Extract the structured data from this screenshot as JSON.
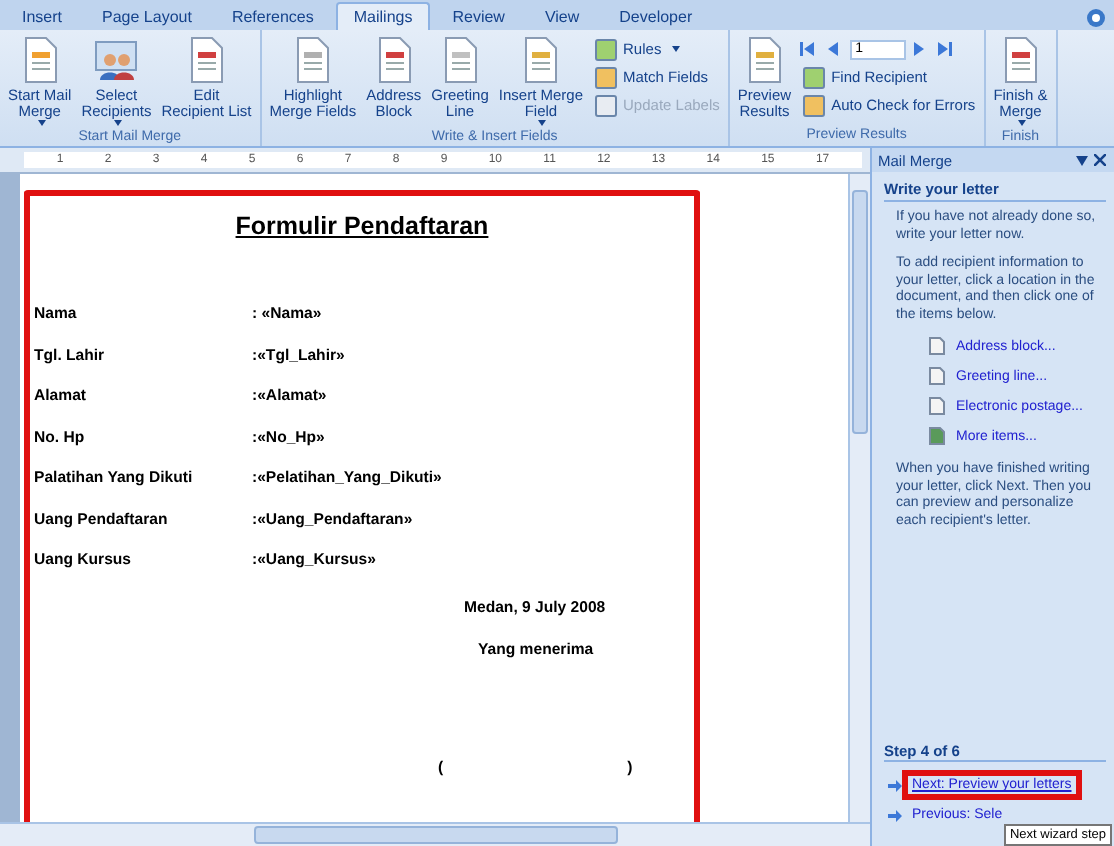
{
  "tabs": [
    {
      "label": "Insert",
      "selected": false
    },
    {
      "label": "Page Layout",
      "selected": false
    },
    {
      "label": "References",
      "selected": false
    },
    {
      "label": "Mailings",
      "selected": true
    },
    {
      "label": "Review",
      "selected": false
    },
    {
      "label": "View",
      "selected": false
    },
    {
      "label": "Developer",
      "selected": false
    }
  ],
  "ribbon_groups": [
    {
      "title": "Start Mail Merge",
      "items": [
        {
          "kind": "large",
          "label": "Start Mail\nMerge",
          "has_menu": true
        },
        {
          "kind": "large",
          "label": "Select\nRecipients",
          "has_menu": true
        },
        {
          "kind": "large",
          "label": "Edit\nRecipient List",
          "has_menu": false
        }
      ]
    },
    {
      "title": "Write & Insert Fields",
      "items": [
        {
          "kind": "large",
          "label": "Highlight\nMerge Fields",
          "has_menu": false
        },
        {
          "kind": "large",
          "label": "Address\nBlock",
          "has_menu": false
        },
        {
          "kind": "large",
          "label": "Greeting\nLine",
          "has_menu": false
        },
        {
          "kind": "large",
          "label": "Insert Merge\nField",
          "has_menu": true
        },
        {
          "kind": "stack",
          "items": [
            {
              "label": "Rules",
              "has_menu": true,
              "disabled": false
            },
            {
              "label": "Match Fields",
              "has_menu": false,
              "disabled": false
            },
            {
              "label": "Update Labels",
              "has_menu": false,
              "disabled": true
            }
          ]
        }
      ]
    },
    {
      "title": "Preview Results",
      "items": [
        {
          "kind": "large",
          "label": "Preview\nResults",
          "has_menu": false
        },
        {
          "kind": "nav",
          "record": "1",
          "items": [
            {
              "label": "Find Recipient",
              "has_menu": false,
              "disabled": false
            },
            {
              "label": "Auto Check for Errors",
              "has_menu": false,
              "disabled": false
            }
          ]
        }
      ]
    },
    {
      "title": "Finish",
      "items": [
        {
          "kind": "large",
          "label": "Finish &\nMerge",
          "has_menu": true
        }
      ]
    }
  ],
  "ruler_marks": [
    "1",
    "2",
    "3",
    "4",
    "5",
    "6",
    "7",
    "8",
    "9",
    "10",
    "11",
    "12",
    "13",
    "14",
    "15",
    "17"
  ],
  "document": {
    "highlighted": true,
    "title": "Formulir Pendaftaran",
    "fields": [
      {
        "label": "Nama",
        "value": ": «Nama»"
      },
      {
        "label": "Tgl. Lahir",
        "value": ":«Tgl_Lahir»"
      },
      {
        "label": "Alamat",
        "value": ":«Alamat»"
      },
      {
        "label": "No. Hp",
        "value": ":«No_Hp»"
      },
      {
        "label": "Palatihan Yang Dikuti",
        "value": ":«Pelatihan_Yang_Dikuti»"
      },
      {
        "label": "Uang Pendaftaran",
        "value": ":«Uang_Pendaftaran»"
      },
      {
        "label": "Uang Kursus",
        "value": ":«Uang_Kursus»"
      }
    ],
    "date": "Medan, 9 July 2008",
    "receiver": "Yang menerima",
    "signature_open": "(",
    "signature_close": ")"
  },
  "task_pane": {
    "title": "Mail Merge",
    "section_title": "Write your letter",
    "paragraphs": [
      "If you have not already done so, write your letter now.",
      "To add recipient information to your letter, click a location in the document, and then click one of the items below."
    ],
    "links": [
      {
        "label": "Address block..."
      },
      {
        "label": "Greeting line..."
      },
      {
        "label": "Electronic postage..."
      },
      {
        "label": "More items..."
      }
    ],
    "closing": "When you have finished writing your letter, click Next. Then you can preview and personalize each recipient's letter.",
    "step": "Step 4 of 6",
    "next_link": {
      "label": "Next: Preview your letters",
      "highlighted": true
    },
    "previous_link": {
      "label": "Previous: Sele"
    },
    "tooltip": "Next wizard step"
  }
}
